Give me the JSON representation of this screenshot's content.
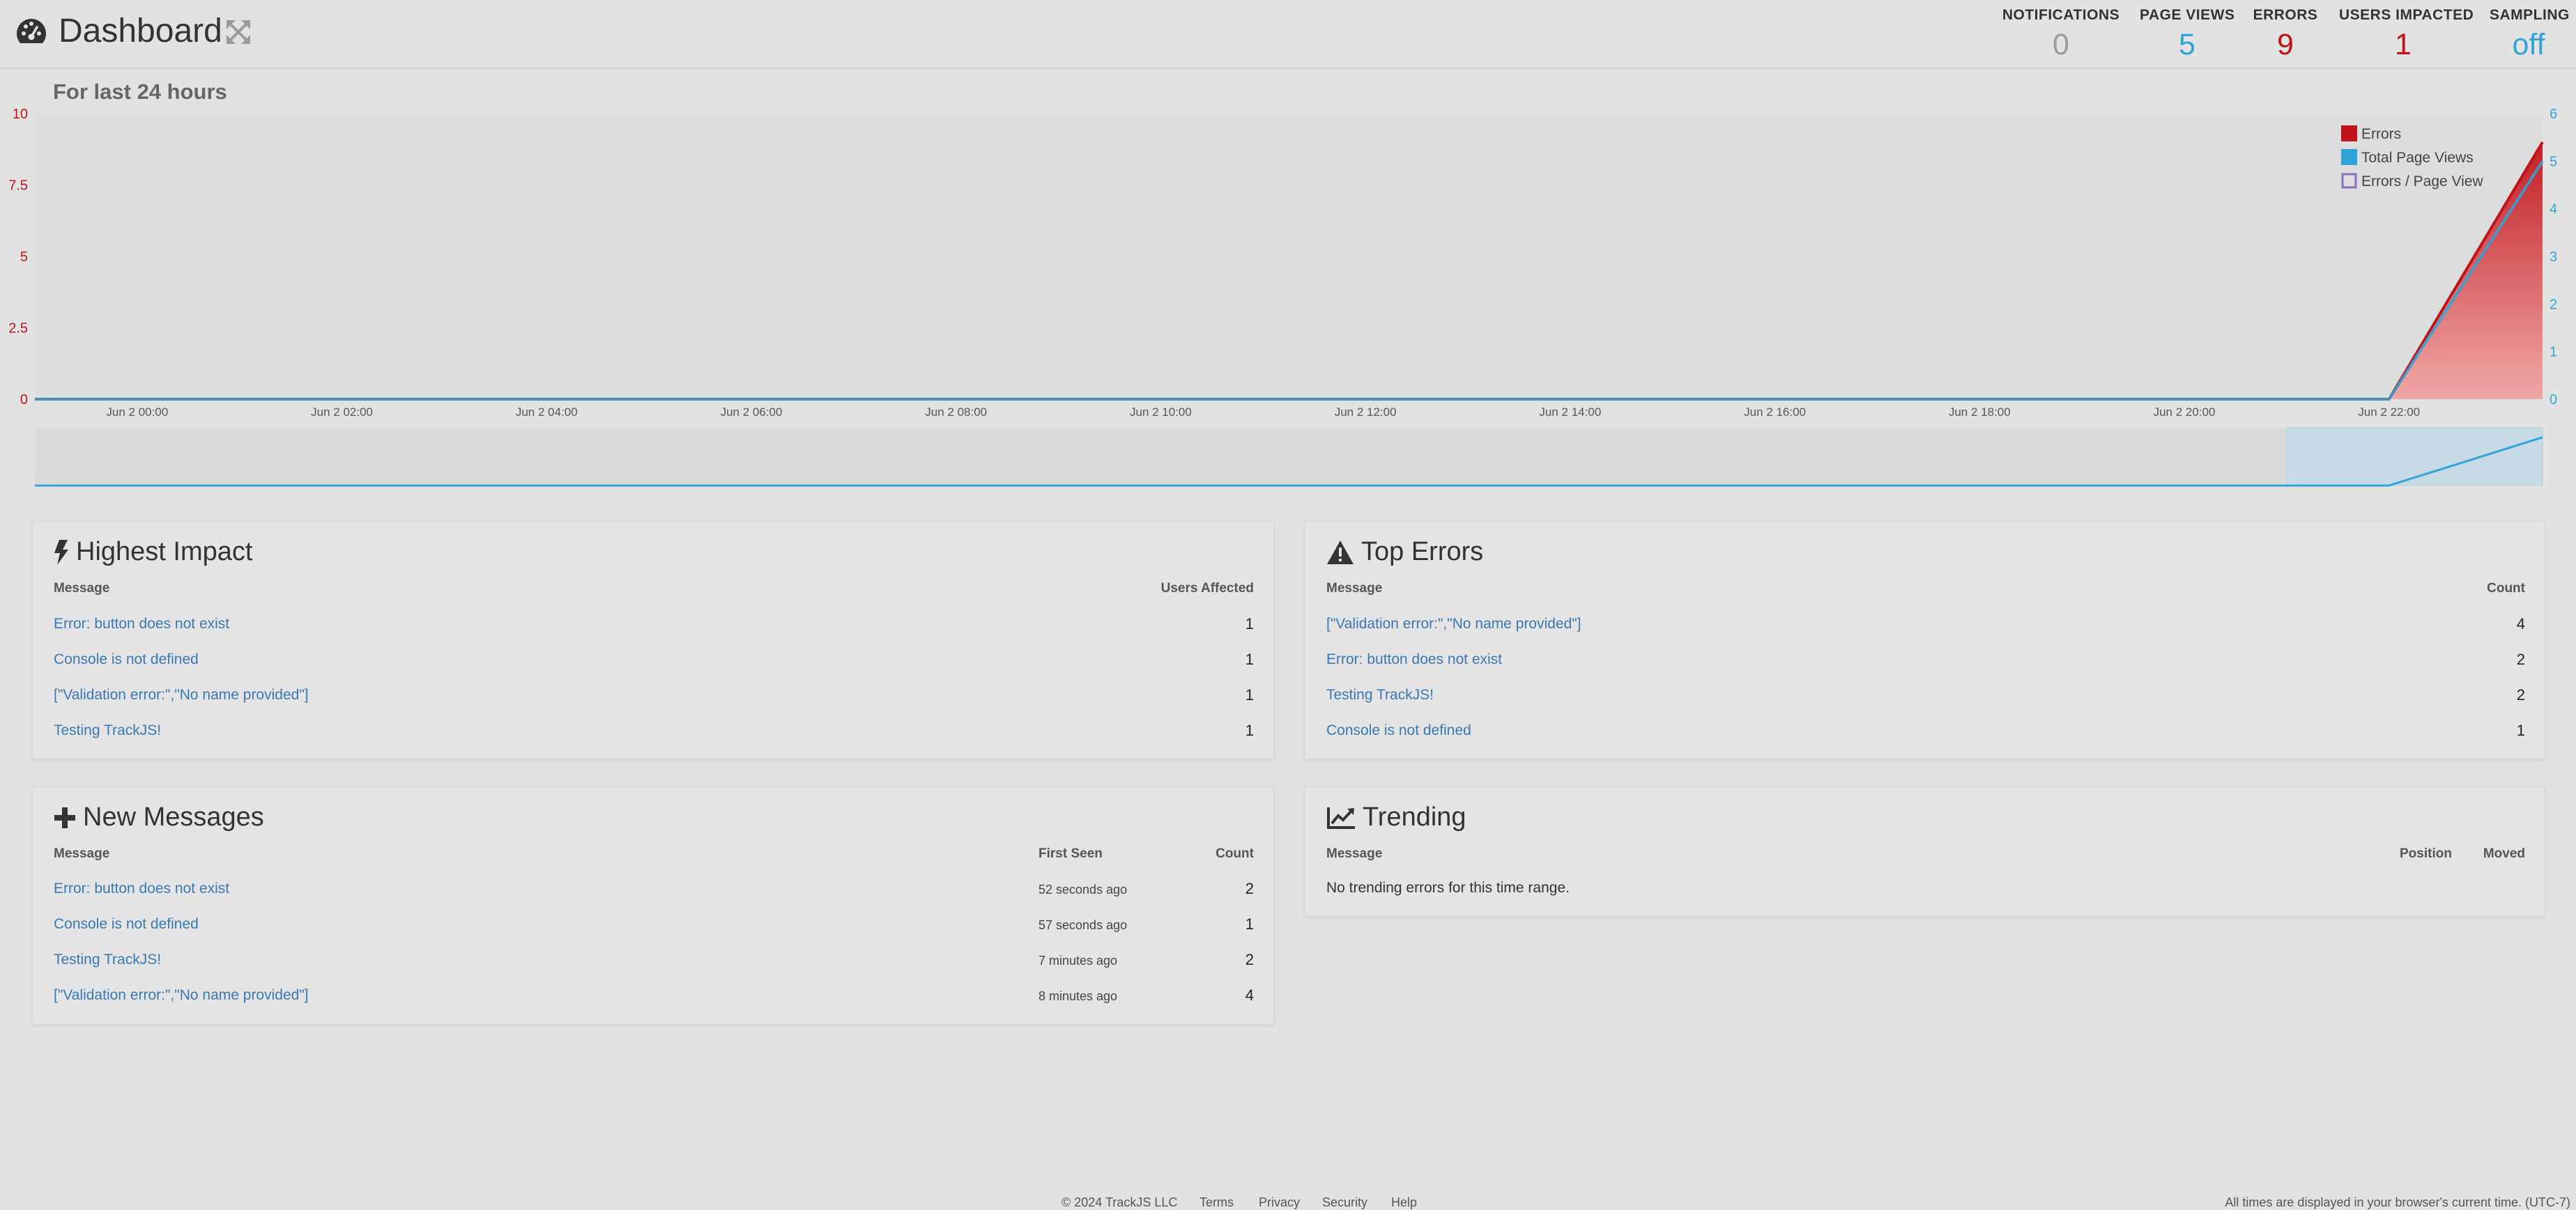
{
  "header": {
    "title": "Dashboard",
    "stats": [
      {
        "label": "NOTIFICATIONS",
        "value": "0",
        "color": "#9a9a9a"
      },
      {
        "label": "PAGE VIEWS",
        "value": "5",
        "color": "#2fa4d8"
      },
      {
        "label": "ERRORS",
        "value": "9",
        "color": "#c0141a"
      },
      {
        "label": "USERS IMPACTED",
        "value": "1",
        "color": "#c0141a"
      },
      {
        "label": "SAMPLING",
        "value": "off",
        "color": "#2fa4d8"
      }
    ]
  },
  "chart_subtitle": "For last 24 hours",
  "chart_data": {
    "type": "area",
    "x": [
      "Jun 2 00:00",
      "Jun 2 02:00",
      "Jun 2 04:00",
      "Jun 2 06:00",
      "Jun 2 08:00",
      "Jun 2 10:00",
      "Jun 2 12:00",
      "Jun 2 14:00",
      "Jun 2 16:00",
      "Jun 2 18:00",
      "Jun 2 20:00",
      "Jun 2 22:00"
    ],
    "x_hours": [
      0,
      2,
      4,
      6,
      8,
      10,
      12,
      14,
      16,
      18,
      20,
      22
    ],
    "x_range_hours": [
      -1,
      23.5
    ],
    "left_axis": {
      "ticks": [
        "0",
        "2.5",
        "5",
        "7.5",
        "10"
      ],
      "ylim": [
        0,
        10
      ],
      "color": "#c0141a"
    },
    "right_axis": {
      "ticks": [
        "0",
        "1",
        "2",
        "3",
        "4",
        "5",
        "6"
      ],
      "ylim": [
        0,
        6
      ],
      "color": "#2fa4d8"
    },
    "series": [
      {
        "name": "Errors",
        "axis": "left",
        "color": "#c0141a",
        "points": [
          [
            -1,
            0
          ],
          [
            22,
            0
          ],
          [
            23.5,
            9
          ]
        ]
      },
      {
        "name": "Total Page Views",
        "axis": "right",
        "color": "#2fa4d8",
        "points": [
          [
            -1,
            0
          ],
          [
            22,
            0
          ],
          [
            23.5,
            5
          ]
        ]
      },
      {
        "name": "Errors / Page View",
        "axis": "right",
        "color": "#8a6fc0",
        "points": []
      }
    ],
    "legend": [
      "Errors",
      "Total Page Views",
      "Errors / Page View"
    ],
    "legend_position": "top-right",
    "navigator_selection_hours": [
      21,
      23.5
    ]
  },
  "panels": {
    "highest_impact": {
      "title": "Highest Impact",
      "col_message": "Message",
      "col_value": "Users Affected",
      "rows": [
        {
          "message": "Error: button does not exist",
          "value": "1"
        },
        {
          "message": "Console is not defined",
          "value": "1"
        },
        {
          "message": "[\"Validation error:\",\"No name provided\"]",
          "value": "1"
        },
        {
          "message": "Testing TrackJS!",
          "value": "1"
        }
      ]
    },
    "top_errors": {
      "title": "Top Errors",
      "col_message": "Message",
      "col_value": "Count",
      "rows": [
        {
          "message": "[\"Validation error:\",\"No name provided\"]",
          "value": "4"
        },
        {
          "message": "Error: button does not exist",
          "value": "2"
        },
        {
          "message": "Testing TrackJS!",
          "value": "2"
        },
        {
          "message": "Console is not defined",
          "value": "1"
        }
      ]
    },
    "new_messages": {
      "title": "New Messages",
      "col_message": "Message",
      "col_first_seen": "First Seen",
      "col_value": "Count",
      "rows": [
        {
          "message": "Error: button does not exist",
          "first_seen": "52 seconds ago",
          "value": "2"
        },
        {
          "message": "Console is not defined",
          "first_seen": "57 seconds ago",
          "value": "1"
        },
        {
          "message": "Testing TrackJS!",
          "first_seen": "7 minutes ago",
          "value": "2"
        },
        {
          "message": "[\"Validation error:\",\"No name provided\"]",
          "first_seen": "8 minutes ago",
          "value": "4"
        }
      ]
    },
    "trending": {
      "title": "Trending",
      "col_message": "Message",
      "col_position": "Position",
      "col_moved": "Moved",
      "empty_text": "No trending errors for this time range."
    }
  },
  "footer": {
    "copyright": "© 2024 TrackJS LLC",
    "links": [
      "Terms",
      "Privacy",
      "Security",
      "Help"
    ],
    "timezone_note": "All times are displayed in your browser's current time. (UTC-7)"
  }
}
